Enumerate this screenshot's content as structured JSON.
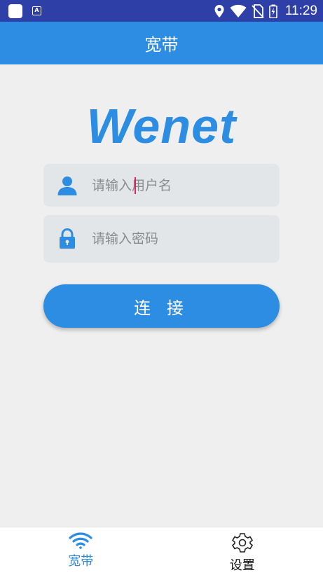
{
  "status_bar": {
    "time": "11:29"
  },
  "app_bar": {
    "title": "宽带"
  },
  "logo": {
    "text": "Wenet"
  },
  "login": {
    "username_placeholder": "请输入用户名",
    "password_placeholder": "请输入密码",
    "connect_label": "连 接"
  },
  "bottom_nav": {
    "items": [
      {
        "label": "宽带",
        "icon": "wifi-icon",
        "active": true
      },
      {
        "label": "设置",
        "icon": "gear-icon",
        "active": false
      }
    ]
  },
  "colors": {
    "primary": "#2d8de2",
    "status_bar": "#2f3fa8",
    "background": "#efefef",
    "field_bg": "#e3e6e8"
  }
}
